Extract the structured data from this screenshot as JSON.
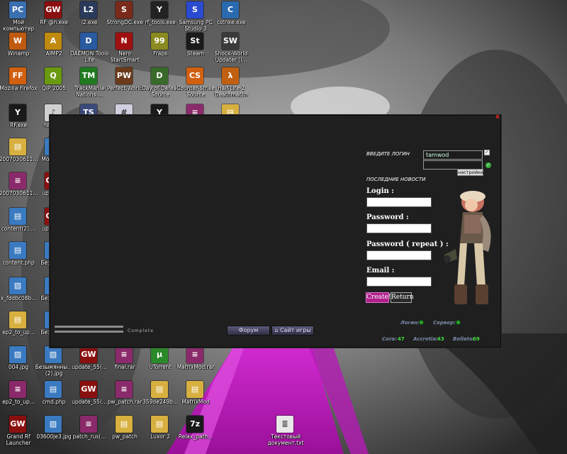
{
  "desktop": {
    "icons": [
      {
        "label": "Мой компьютер",
        "color": "#3a6fb0",
        "glyph": "PC"
      },
      {
        "label": "RF @n.exe",
        "color": "#8a1010",
        "glyph": "GW"
      },
      {
        "label": "l2.exe",
        "color": "#2a3a5a",
        "glyph": "L2"
      },
      {
        "label": "StrongDC.exe",
        "color": "#7a2a1a",
        "glyph": "S"
      },
      {
        "label": "rf_tools.exe",
        "color": "#222222",
        "glyph": "Y"
      },
      {
        "label": "Samsung PC Studio 3",
        "color": "#2a4ad0",
        "glyph": "S"
      },
      {
        "label": "cstrike.exe",
        "color": "#2a6ab0",
        "glyph": "C"
      },
      {
        "label": "Winamp",
        "color": "#c05a10",
        "glyph": "W"
      },
      {
        "label": "AIMP2",
        "color": "#c08a10",
        "glyph": "A"
      },
      {
        "label": "DAEMON Tools Lite",
        "color": "#2a5aa0",
        "glyph": "D"
      },
      {
        "label": "Nero StartSmart",
        "color": "#a01010",
        "glyph": "N"
      },
      {
        "label": "Fraps",
        "color": "#8a8a20",
        "glyph": "99"
      },
      {
        "label": "Steam",
        "color": "#1a1a1a",
        "glyph": "St"
      },
      {
        "label": "Shock-World Updater [I...",
        "color": "#3a3a3a",
        "glyph": "SW"
      },
      {
        "label": "Mozilla Firefox",
        "color": "#d06010",
        "glyph": "FF"
      },
      {
        "label": "QIP 2005",
        "color": "#6a9a10",
        "glyph": "Q"
      },
      {
        "label": "TrackMania Nations ...",
        "color": "#207a20",
        "glyph": "TM"
      },
      {
        "label": "Perfect World",
        "color": "#6a3a1a",
        "glyph": "PW"
      },
      {
        "label": "Day of Defeat Source",
        "color": "#3a6a2a",
        "glyph": "D"
      },
      {
        "label": "Counter-Strike Source",
        "color": "#d06010",
        "glyph": "CS"
      },
      {
        "label": "Half-Life 2 Deathmatch",
        "color": "#c06010",
        "glyph": "λ"
      },
      {
        "label": "RF.exe",
        "color": "#1a1a1a",
        "glyph": "Y"
      },
      {
        "label": "nashe...",
        "color": "#d0d0d0",
        "glyph": "♪"
      },
      {
        "label": "",
        "color": "#3a4a7a",
        "glyph": "TS"
      },
      {
        "label": "",
        "color": "#d0d0e0",
        "glyph": "#"
      },
      {
        "label": "",
        "color": "#1a1a1a",
        "glyph": "Y"
      },
      {
        "label": "",
        "color": "#8a2a6a",
        "glyph": "≡"
      },
      {
        "label": "",
        "color": "#d8b040",
        "glyph": "▤"
      },
      {
        "label": "2007030611...",
        "color": "#d8b040",
        "glyph": "▤"
      },
      {
        "label": "Mounta...",
        "color": "#3a7ac0",
        "glyph": "▨"
      },
      {
        "label": "2007030611...",
        "color": "#8a2a6a",
        "glyph": "≡"
      },
      {
        "label": "update...",
        "color": "#8a1010",
        "glyph": "GW"
      },
      {
        "label": "content(2)....",
        "color": "#3a7ac0",
        "glyph": "▤"
      },
      {
        "label": "update...",
        "color": "#8a1010",
        "glyph": "GW"
      },
      {
        "label": "content.php",
        "color": "#3a7ac0",
        "glyph": "▤"
      },
      {
        "label": "Безымя...",
        "color": "#3a7ac0",
        "glyph": "▨"
      },
      {
        "label": "x_fddbc08b...",
        "color": "#3a7ac0",
        "glyph": "▨"
      },
      {
        "label": "Безымя...",
        "color": "#3a7ac0",
        "glyph": "▨"
      },
      {
        "label": "ep2_to_up...",
        "color": "#d8b040",
        "glyph": "▤"
      },
      {
        "label": "Безымя...",
        "color": "#3a7ac0",
        "glyph": "▨"
      },
      {
        "label": "004.jpg",
        "color": "#3a7ac0",
        "glyph": "▨"
      },
      {
        "label": "Безымянны... (2).jpg",
        "color": "#3a7ac0",
        "glyph": "▨"
      },
      {
        "label": "update_55(...",
        "color": "#8a1010",
        "glyph": "GW"
      },
      {
        "label": "final.rar",
        "color": "#8a2a6a",
        "glyph": "≡"
      },
      {
        "label": "uTorrent",
        "color": "#2a8a2a",
        "glyph": "µ"
      },
      {
        "label": "MatrixMod.rar",
        "color": "#8a2a6a",
        "glyph": "≡"
      },
      {
        "label": "ep2_to_up...",
        "color": "#8a2a6a",
        "glyph": "≡"
      },
      {
        "label": "cmd.php",
        "color": "#3a7ac0",
        "glyph": "▤"
      },
      {
        "label": "update_55(...",
        "color": "#8a1010",
        "glyph": "GW"
      },
      {
        "label": "pw_patch.rar",
        "color": "#8a2a6a",
        "glyph": "≡"
      },
      {
        "label": "359de249b...",
        "color": "#d8b040",
        "glyph": "▤"
      },
      {
        "label": "MatrixMod",
        "color": "#d8b040",
        "glyph": "▤"
      },
      {
        "label": "Grand Rf Launcher",
        "color": "#8a1010",
        "glyph": "GW"
      },
      {
        "label": "03600je3.jpg",
        "color": "#3a7ac0",
        "glyph": "▨"
      },
      {
        "label": "patch_rus(...",
        "color": "#8a2a6a",
        "glyph": "≡"
      },
      {
        "label": "pw_patch",
        "color": "#d8b040",
        "glyph": "▤"
      },
      {
        "label": "Luxor 2",
        "color": "#d8b040",
        "glyph": "▤"
      },
      {
        "label": "Relax_path...",
        "color": "#1a1a1a",
        "glyph": "7z"
      },
      {
        "label": "Текстовый документ.txt",
        "color": "#e8e8e8",
        "glyph": "≣"
      }
    ]
  },
  "launcher": {
    "close_glyph": "x",
    "login_section_label": "ВВЕДИТЕ ЛОГИН",
    "login_value": "tamwod",
    "password_value": "",
    "settings_button": "настройки",
    "news_section_label": "ПОСЛЕДНИЕ НОВОСТИ",
    "form": {
      "login_label": "Login :",
      "password_label": "Password :",
      "password_repeat_label": "Password ( repeat ) :",
      "email_label": "Email :",
      "create_button": "Create!",
      "return_button": "Return"
    },
    "status": {
      "login_label": "Логин:",
      "server_label": "Сервер:",
      "cora_label": "Cora:",
      "cora_value": "47",
      "accretia_label": "Accretia:",
      "accretia_value": "43",
      "bellato_label": "Bellato:",
      "bellato_value": "69"
    },
    "progress": {
      "complete_label": "Complete",
      "bar1_fraction": 1,
      "bar2_fraction": 1
    },
    "nav": {
      "forum_button": "Форум",
      "site_button": "Сайт игры"
    }
  },
  "colors": {
    "launcher_bg": "#1f1f1f",
    "create_button_bg": "#b0208a",
    "status_ok": "#2fa02f"
  }
}
